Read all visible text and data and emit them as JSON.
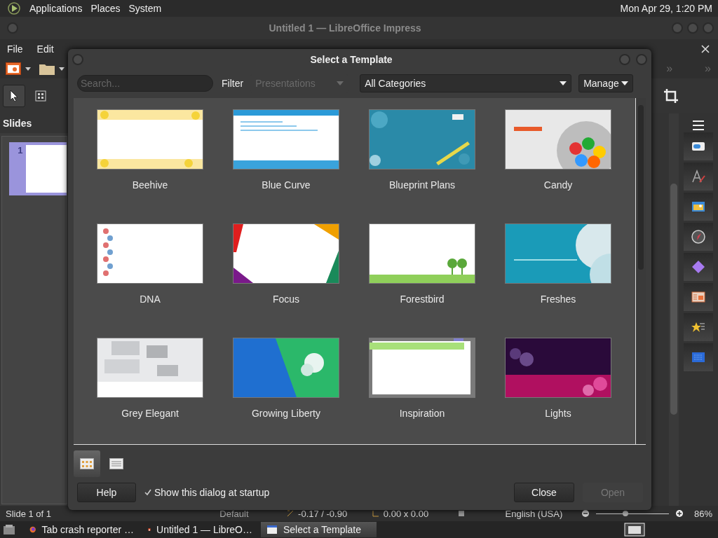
{
  "top_panel": {
    "menus": [
      "Applications",
      "Places",
      "System"
    ],
    "clock": "Mon Apr 29, 1:20 PM"
  },
  "window": {
    "title": "Untitled 1 — LibreOffice Impress"
  },
  "menu_bar": [
    "File",
    "Edit"
  ],
  "toolbar": {
    "overflow_marks": [
      "»",
      "»"
    ]
  },
  "slides_panel": {
    "title": "Slides",
    "slides": [
      {
        "number": "1",
        "selected": true
      }
    ]
  },
  "dialog": {
    "title": "Select a Template",
    "search": {
      "placeholder": "Search..."
    },
    "filter_label": "Filter",
    "filter": {
      "value": "Presentations",
      "disabled": true
    },
    "category": {
      "value": "All Categories"
    },
    "manage_button": "Manage",
    "templates": [
      {
        "name": "Beehive",
        "selected": false
      },
      {
        "name": "Blue Curve",
        "selected": false
      },
      {
        "name": "Blueprint Plans",
        "selected": false
      },
      {
        "name": "Candy",
        "selected": false
      },
      {
        "name": "DNA",
        "selected": false
      },
      {
        "name": "Focus",
        "selected": false
      },
      {
        "name": "Forestbird",
        "selected": false
      },
      {
        "name": "Freshes",
        "selected": false
      },
      {
        "name": "Grey Elegant",
        "selected": false
      },
      {
        "name": "Growing Liberty",
        "selected": false
      },
      {
        "name": "Inspiration",
        "selected": false
      },
      {
        "name": "Lights",
        "selected": false
      }
    ],
    "view_modes": [
      {
        "kind": "thumbnails",
        "selected": true
      },
      {
        "kind": "list",
        "selected": false
      }
    ],
    "help_button": "Help",
    "startup_checkbox": {
      "label": "Show this dialog at startup",
      "checked": true
    },
    "buttons": [
      {
        "label": "Close",
        "disabled": false
      },
      {
        "label": "Open",
        "disabled": true
      }
    ]
  },
  "status_bar": {
    "slide": "Slide 1 of 1",
    "layout": "Default",
    "position": "-0.17 / -0.90",
    "size": "0.00 x 0.00",
    "language": "English (USA)",
    "zoom_slider": {
      "level": 0.4
    },
    "zoom": "86%"
  },
  "taskbar": [
    {
      "kind": "browser",
      "label": "Tab crash reporter …",
      "selected": false
    },
    {
      "kind": "impress",
      "label": "Untitled 1 — LibreO…",
      "selected": false
    },
    {
      "kind": "window",
      "label": "Select a Template",
      "selected": true
    }
  ]
}
